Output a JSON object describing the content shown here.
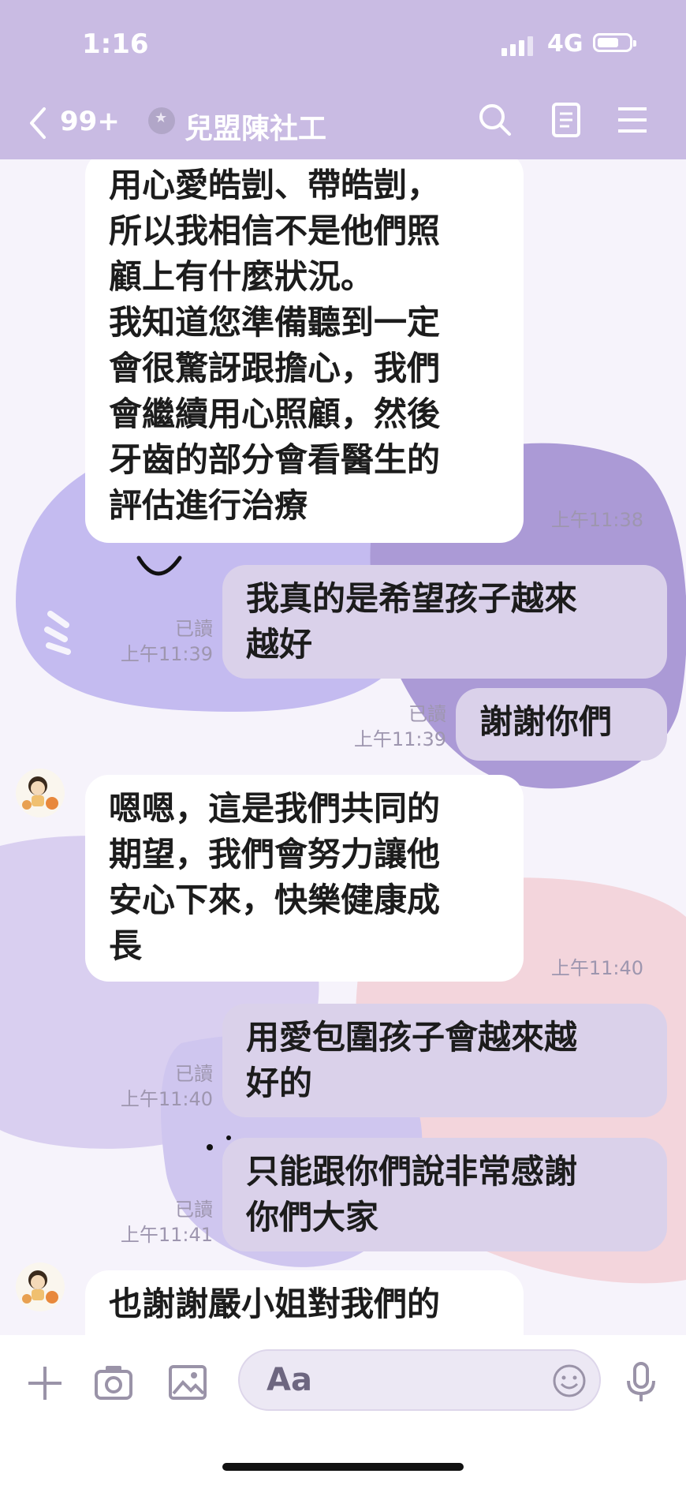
{
  "status_bar": {
    "time": "1:16",
    "network": "4G",
    "battery_icon": "battery-icon",
    "signal_icon": "signal-icon"
  },
  "header": {
    "unread_count": "99+",
    "chat_name": "兒盟陳社工",
    "icons": [
      "back-chevron-icon",
      "star-badge-icon",
      "search-icon",
      "notes-icon",
      "menu-icon"
    ]
  },
  "messages": [
    {
      "side": "in",
      "text": "用心愛皓剴、帶皓剴，\n所以我相信不是他們照\n顧上有什麼狀況。\n我知道您準備聽到一定\n會很驚訝跟擔心，我們\n會繼續用心照顧，然後\n牙齒的部分會看醫生的\n評估進行治療",
      "time": "上午11:38"
    },
    {
      "side": "out",
      "text": "我真的是希望孩子越來\n越好",
      "read": "已讀",
      "time": "上午11:39"
    },
    {
      "side": "out",
      "text": "謝謝你們",
      "read": "已讀",
      "time": "上午11:39"
    },
    {
      "side": "in",
      "text": "嗯嗯，這是我們共同的\n期望，我們會努力讓他\n安心下來，快樂健康成\n長",
      "time": "上午11:40"
    },
    {
      "side": "out",
      "text": "用愛包圍孩子會越來越\n好的",
      "read": "已讀",
      "time": "上午11:40"
    },
    {
      "side": "out",
      "text": "只能跟你們說非常感謝\n你們大家",
      "read": "已讀",
      "time": "上午11:41"
    },
    {
      "side": "in",
      "text": "也謝謝嚴小姐對我們的"
    }
  ],
  "composer": {
    "placeholder": "Aa",
    "icons": [
      "add-icon",
      "camera-icon",
      "image-icon",
      "emoji-icon",
      "microphone-icon"
    ]
  },
  "colors": {
    "header_bg": "#c9bbe3",
    "outgoing_bubble": "#dad1ea",
    "incoming_bubble": "#ffffff",
    "timestamp": "#9e96af"
  }
}
